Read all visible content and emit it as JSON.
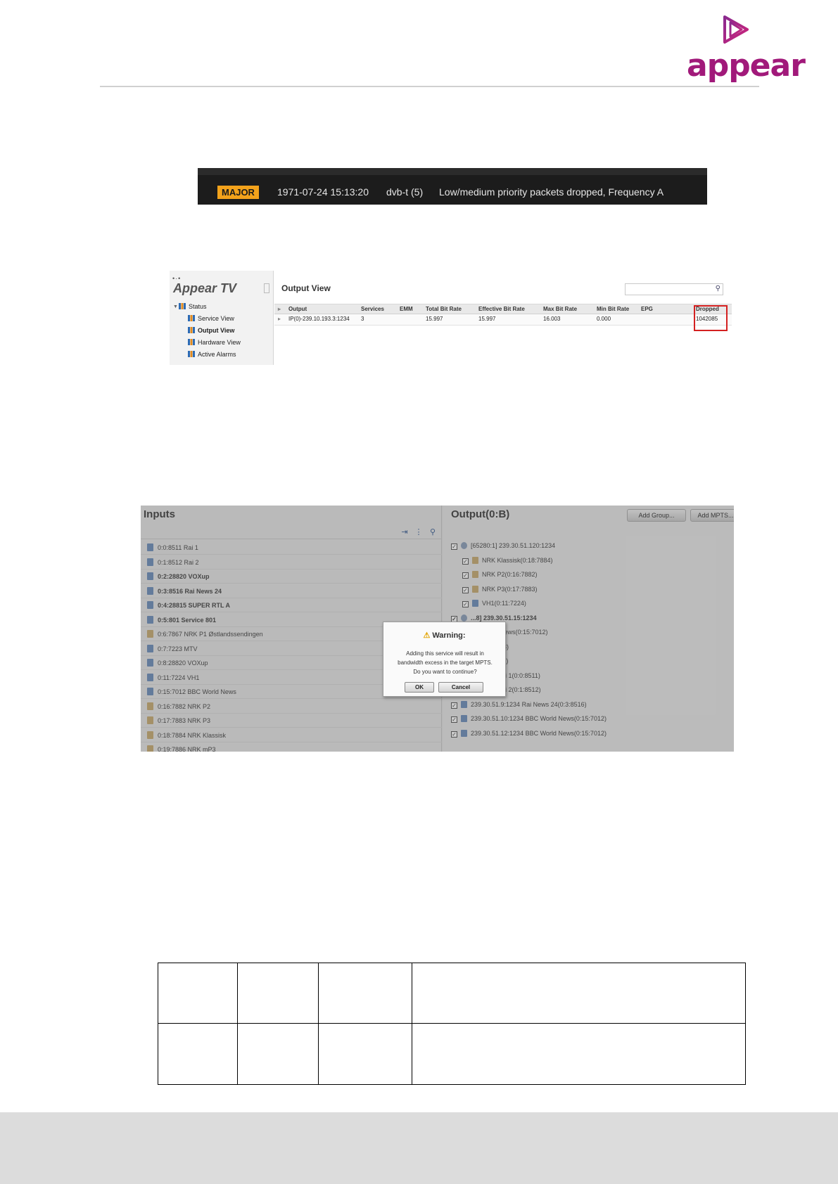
{
  "header": {
    "brand": "appear"
  },
  "alarm": {
    "severity": "MAJOR",
    "timestamp": "1971-07-24 15:13:20",
    "source": "dvb-t (5)",
    "message": "Low/medium priority packets dropped, Frequency A",
    "colors": {
      "badge": "#f3a21b",
      "bar": "#1c1c1c"
    }
  },
  "output_view": {
    "app_title": "Appear TV",
    "page_title": "Output View",
    "tree": {
      "root": "Status",
      "items": [
        "Service View",
        "Output View",
        "Hardware View",
        "Active Alarms"
      ],
      "selected": "Output View"
    },
    "columns": [
      "Output",
      "Services",
      "EMM",
      "Total Bit Rate",
      "Effective Bit Rate",
      "Max Bit Rate",
      "Min Bit Rate",
      "EPG",
      "Dropped"
    ],
    "row": {
      "output": "IP(0)-239.10.193.3:1234",
      "services": "3",
      "emm": "",
      "total_bit_rate": "15.997",
      "effective_bit_rate": "15.997",
      "max_bit_rate": "16.003",
      "min_bit_rate": "0.000",
      "epg": "",
      "dropped": "1042085"
    }
  },
  "io_dialog": {
    "inputs_title": "Inputs",
    "output_title": "Output(0:B)",
    "buttons": {
      "add_group": "Add Group...",
      "add_mpts": "Add MPTS..."
    },
    "inputs": [
      {
        "label": "0:0:8511 Rai 1",
        "bold": false,
        "icon": "doc"
      },
      {
        "label": "0:1:8512 Rai 2",
        "bold": false,
        "icon": "doc"
      },
      {
        "label": "0:2:28820 VOXup",
        "bold": true,
        "icon": "doc"
      },
      {
        "label": "0:3:8516 Rai News 24",
        "bold": true,
        "icon": "doc"
      },
      {
        "label": "0:4:28815 SUPER RTL A",
        "bold": true,
        "icon": "doc"
      },
      {
        "label": "0:5:801 Service 801",
        "bold": true,
        "icon": "doc"
      },
      {
        "label": "0:6:7867 NRK P1 Østlandssendingen",
        "bold": false,
        "icon": "fold"
      },
      {
        "label": "0:7:7223 MTV",
        "bold": false,
        "icon": "doc"
      },
      {
        "label": "0:8:28820 VOXup",
        "bold": false,
        "icon": "doc"
      },
      {
        "label": "0:11:7224 VH1",
        "bold": false,
        "icon": "doc"
      },
      {
        "label": "0:15:7012 BBC World News",
        "bold": false,
        "icon": "doc"
      },
      {
        "label": "0:16:7882 NRK P2",
        "bold": false,
        "icon": "fold"
      },
      {
        "label": "0:17:7883 NRK P3",
        "bold": false,
        "icon": "fold"
      },
      {
        "label": "0:18:7884 NRK Klassisk",
        "bold": false,
        "icon": "fold"
      },
      {
        "label": "0:19:7886 NRK mP3",
        "bold": false,
        "icon": "fold"
      }
    ],
    "outputs": [
      {
        "label": "[65280:1] 239.30.51.120:1234",
        "bold": false,
        "icon": "globe",
        "indent": 0
      },
      {
        "label": "NRK Klassisk(0:18:7884)",
        "bold": false,
        "icon": "fold",
        "indent": 1
      },
      {
        "label": "NRK P2(0:16:7882)",
        "bold": false,
        "icon": "fold",
        "indent": 1
      },
      {
        "label": "NRK P3(0:17:7883)",
        "bold": false,
        "icon": "fold",
        "indent": 1
      },
      {
        "label": "VH1(0:11:7224)",
        "bold": false,
        "icon": "doc",
        "indent": 1
      },
      {
        "label": "...8] 239.30.51.15:1234",
        "bold": true,
        "icon": "globe",
        "indent": 0
      },
      {
        "label": "...orld News(0:15:7012)",
        "bold": false,
        "icon": "doc",
        "indent": 1
      },
      {
        "label": "...7:7223)",
        "bold": false,
        "icon": "doc",
        "indent": 1
      },
      {
        "label": "...0:8511)",
        "bold": false,
        "icon": "doc",
        "indent": 1
      },
      {
        "label": "...6:1234 Rai 1(0:0:8511)",
        "bold": false,
        "icon": "doc",
        "indent": 0
      },
      {
        "label": "...7:1234 Rai 2(0:1:8512)",
        "bold": false,
        "icon": "doc",
        "indent": 0
      },
      {
        "label": "239.30.51.9:1234 Rai News 24(0:3:8516)",
        "bold": false,
        "icon": "doc",
        "indent": 0
      },
      {
        "label": "239.30.51.10:1234 BBC World News(0:15:7012)",
        "bold": false,
        "icon": "doc",
        "indent": 0
      },
      {
        "label": "239.30.51.12:1234 BBC World News(0:15:7012)",
        "bold": false,
        "icon": "doc",
        "indent": 0
      }
    ],
    "warning": {
      "title": "Warning:",
      "lines": [
        "Adding this service will result in",
        "bandwidth excess in the target MPTS.",
        "Do you want to continue?"
      ],
      "ok": "OK",
      "cancel": "Cancel"
    }
  },
  "table": {
    "rows": [
      [
        "",
        "",
        "",
        ""
      ],
      [
        "",
        "",
        "",
        ""
      ]
    ]
  }
}
